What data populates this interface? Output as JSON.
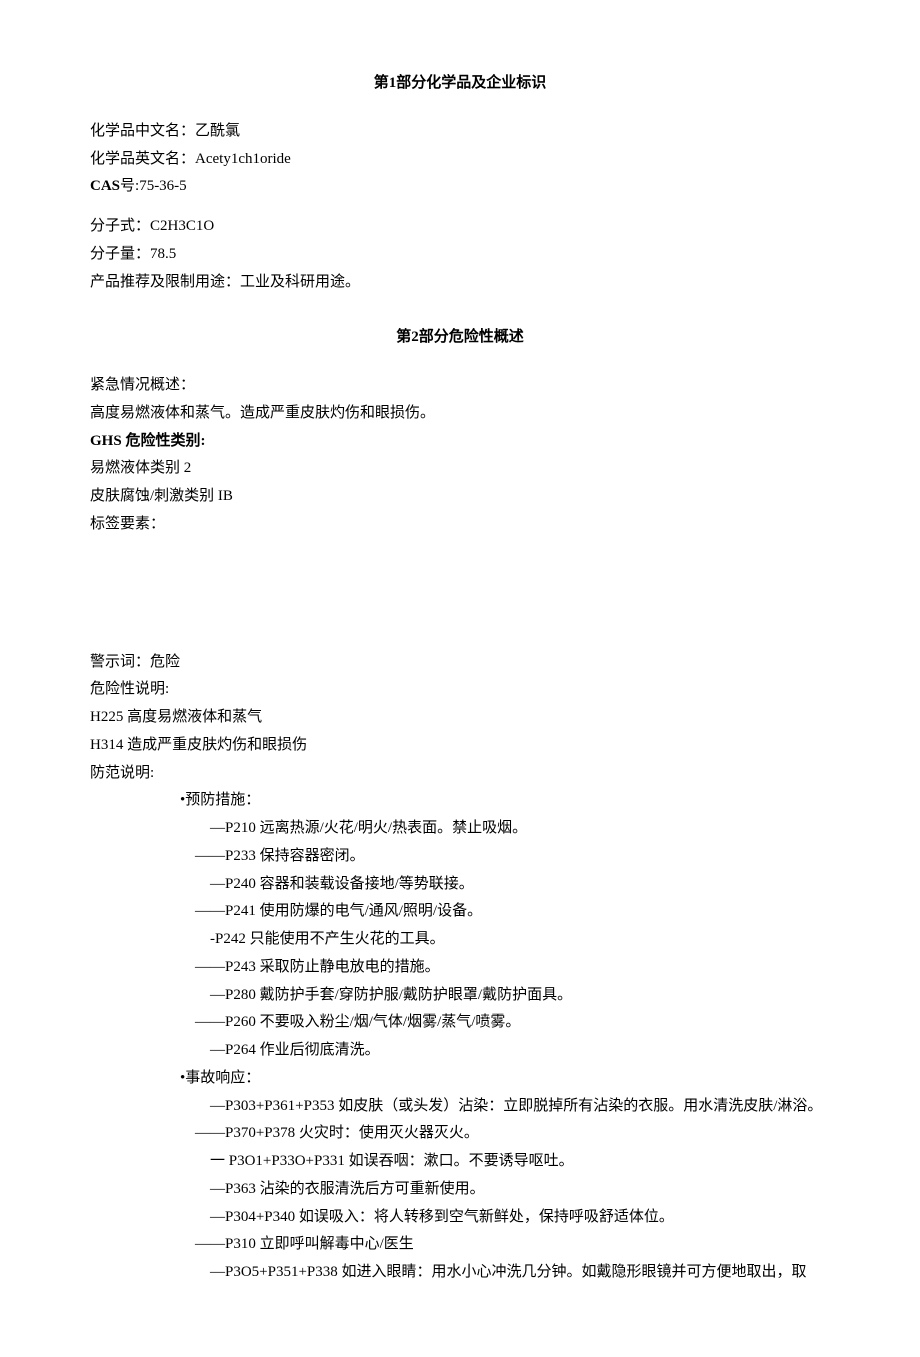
{
  "section1": {
    "title_prefix": "第",
    "title_num": "1",
    "title_suffix": "部分化学品及企业标识",
    "name_cn_label": "化学品中文名：",
    "name_cn": "乙酰氯",
    "name_en_label": "化学品英文名：",
    "name_en": "Acety1ch1oride",
    "cas_label": "CAS",
    "cas_sep": "号:",
    "cas_num": "75-36-5",
    "formula_label": "分子式：",
    "formula": "C2H3C1O",
    "mw_label": "分子量：",
    "mw": "78.5",
    "use_label": "产品推荐及限制用途：",
    "use": "工业及科研用途。"
  },
  "section2": {
    "title_prefix": "第",
    "title_num": "2",
    "title_suffix": "部分危险性概述",
    "emergency_label": "紧急情况概述：",
    "emergency": "高度易燃液体和蒸气。造成严重皮肤灼伤和眼损伤。",
    "ghs_label_prefix": "GHS",
    "ghs_label_suffix": "危险性类别:",
    "ghs1": "易燃液体类别 2",
    "ghs2": "皮肤腐蚀/刺激类别 IB",
    "label_elements": "标签要素：",
    "signal_label": "警示词：",
    "signal": "危险",
    "hazard_label": "危险性说明:",
    "h1_code": "H225",
    "h1_text": "高度易燃液体和蒸气",
    "h2_code": "H314",
    "h2_text": "造成严重皮肤灼伤和眼损伤",
    "precaution_label": "防范说明:",
    "prevent_label": "•预防措施：",
    "p_prevent": [
      "—P210 远离热源/火花/明火/热表面。禁止吸烟。",
      "——P233 保持容器密闭。",
      "—P240 容器和装载设备接地/等势联接。",
      "——P241 使用防爆的电气/通风/照明/设备。",
      "-P242 只能使用不产生火花的工具。",
      "——P243 采取防止静电放电的措施。",
      "—P280 戴防护手套/穿防护服/戴防护眼罩/戴防护面具。",
      "——P260 不要吸入粉尘/烟/气体/烟雾/蒸气/喷雾。",
      "—P264 作业后彻底清洗。"
    ],
    "response_label": "•事故响应：",
    "p_response": [
      "—P303+P361+P353 如皮肤（或头发）沾染：立即脱掉所有沾染的衣服。用水清洗皮肤/淋浴。",
      "——P370+P378 火灾时：使用灭火器灭火。",
      "一 P3O1+P33O+P331 如误吞咽：漱口。不要诱导呕吐。",
      "—P363 沾染的衣服清洗后方可重新使用。",
      "—P304+P340 如误吸入：将人转移到空气新鲜处，保持呼吸舒适体位。",
      "——P310 立即呼叫解毒中心/医生",
      "—P3O5+P351+P338 如进入眼睛：用水小心冲洗几分钟。如戴隐形眼镜并可方便地取出，取"
    ]
  }
}
